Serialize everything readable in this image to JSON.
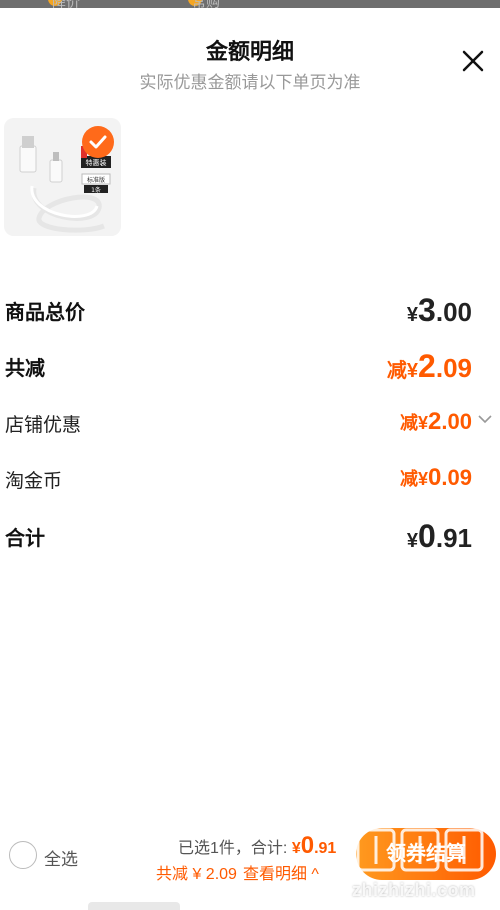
{
  "underlay": {
    "left_label": "降价",
    "right_label": "常购"
  },
  "header": {
    "title": "金额明细",
    "subtitle": "实际优惠金额请以下单页为准"
  },
  "product": {
    "badge_top": "特惠装",
    "badge_spec": "标准版",
    "badge_qty": "1条"
  },
  "rows": {
    "total": {
      "label": "商品总价",
      "currency": "¥",
      "int": "3",
      "dec": ".00"
    },
    "discount": {
      "label": "共减",
      "prefix": "减",
      "currency": "¥",
      "int": "2",
      "dec": ".09"
    },
    "shop": {
      "label": "店铺优惠",
      "prefix": "减",
      "currency": "¥",
      "int": "2",
      "dec": ".00"
    },
    "coins": {
      "label": "淘金币",
      "prefix": "减",
      "currency": "¥",
      "int": "0",
      "dec": ".09"
    },
    "sum": {
      "label": "合计",
      "currency": "¥",
      "int": "0",
      "dec": ".91"
    }
  },
  "bottom": {
    "select_all": "全选",
    "selected": "已选1件，",
    "total_label": "合计: ",
    "total_currency": "¥",
    "total_int": "0",
    "total_dec": ".91",
    "discount_text": "共减 ¥ 2.09",
    "detail_link": "查看明细 ^",
    "checkout": "领券结算"
  },
  "watermark": {
    "text": "zhizhizhi.com"
  },
  "colors": {
    "accent": "#ff5a00",
    "muted": "#999999"
  }
}
